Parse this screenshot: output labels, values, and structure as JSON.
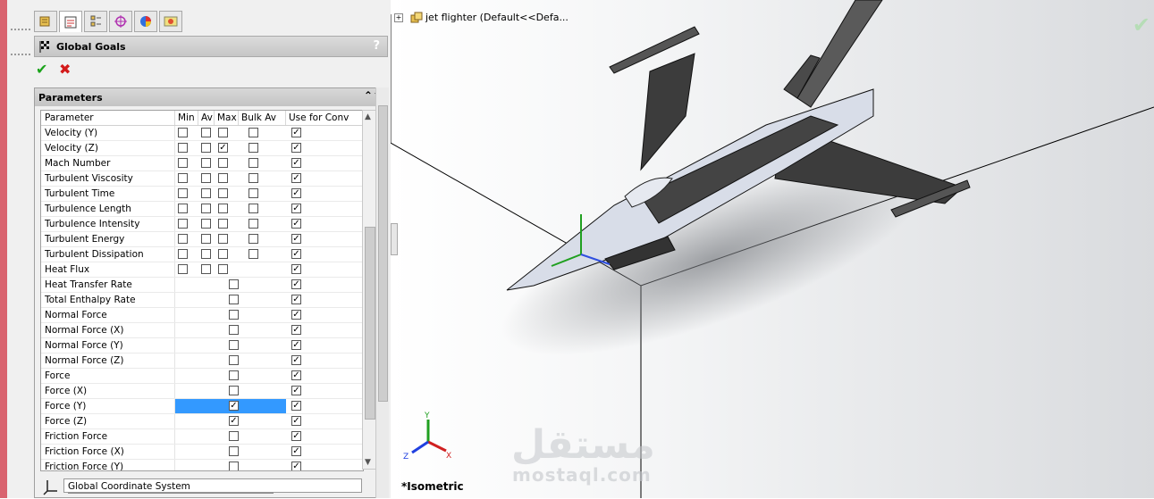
{
  "panel": {
    "title": "Global Goals",
    "help": "?",
    "ok": "✔",
    "cancel": "✖",
    "section": "Parameters",
    "section_toggle": "⌃⌃",
    "columns": [
      "Parameter",
      "Min",
      "Av",
      "Max",
      "Bulk Av",
      "Use for Conv"
    ],
    "rows": [
      {
        "name": "Velocity (Y)",
        "min": false,
        "av": false,
        "max": false,
        "bulk": false,
        "conv": true,
        "full": true
      },
      {
        "name": "Velocity (Z)",
        "min": false,
        "av": false,
        "max": true,
        "bulk": false,
        "conv": true,
        "full": true
      },
      {
        "name": "Mach Number",
        "min": false,
        "av": false,
        "max": false,
        "bulk": false,
        "conv": true,
        "full": true
      },
      {
        "name": "Turbulent Viscosity",
        "min": false,
        "av": false,
        "max": false,
        "bulk": false,
        "conv": true,
        "full": true
      },
      {
        "name": "Turbulent Time",
        "min": false,
        "av": false,
        "max": false,
        "bulk": false,
        "conv": true,
        "full": true
      },
      {
        "name": "Turbulence Length",
        "min": false,
        "av": false,
        "max": false,
        "bulk": false,
        "conv": true,
        "full": true
      },
      {
        "name": "Turbulence Intensity",
        "min": false,
        "av": false,
        "max": false,
        "bulk": false,
        "conv": true,
        "full": true
      },
      {
        "name": "Turbulent Energy",
        "min": false,
        "av": false,
        "max": false,
        "bulk": false,
        "conv": true,
        "full": true
      },
      {
        "name": "Turbulent Dissipation",
        "min": false,
        "av": false,
        "max": false,
        "bulk": false,
        "conv": true,
        "full": true
      },
      {
        "name": "Heat Flux",
        "min": false,
        "av": false,
        "max": false,
        "conv": true,
        "full": "nobulk"
      },
      {
        "name": "Heat Transfer Rate",
        "val": false,
        "conv": true
      },
      {
        "name": "Total Enthalpy Rate",
        "val": false,
        "conv": true
      },
      {
        "name": "Normal Force",
        "val": false,
        "conv": true
      },
      {
        "name": "Normal Force (X)",
        "val": false,
        "conv": true
      },
      {
        "name": "Normal Force (Y)",
        "val": false,
        "conv": true
      },
      {
        "name": "Normal Force (Z)",
        "val": false,
        "conv": true
      },
      {
        "name": "Force",
        "val": false,
        "conv": true
      },
      {
        "name": "Force (X)",
        "val": false,
        "conv": true
      },
      {
        "name": "Force (Y)",
        "val": true,
        "conv": true,
        "highlight": true
      },
      {
        "name": "Force (Z)",
        "val": true,
        "conv": true
      },
      {
        "name": "Friction Force",
        "val": false,
        "conv": true
      },
      {
        "name": "Friction Force (X)",
        "val": false,
        "conv": true
      },
      {
        "name": "Friction Force (Y)",
        "val": false,
        "conv": true
      }
    ],
    "coordinate_system": "Global Coordinate System"
  },
  "viewport": {
    "tree_label": "jet flighter  (Default<<Defa...",
    "view_name": "*Isometric",
    "watermark_arabic": "مستقل",
    "watermark_latin": "mostaql.com"
  },
  "colors": {
    "accent_blue": "#3399ff",
    "check_green": "#1aa31a",
    "cancel_red": "#d31a1a"
  }
}
